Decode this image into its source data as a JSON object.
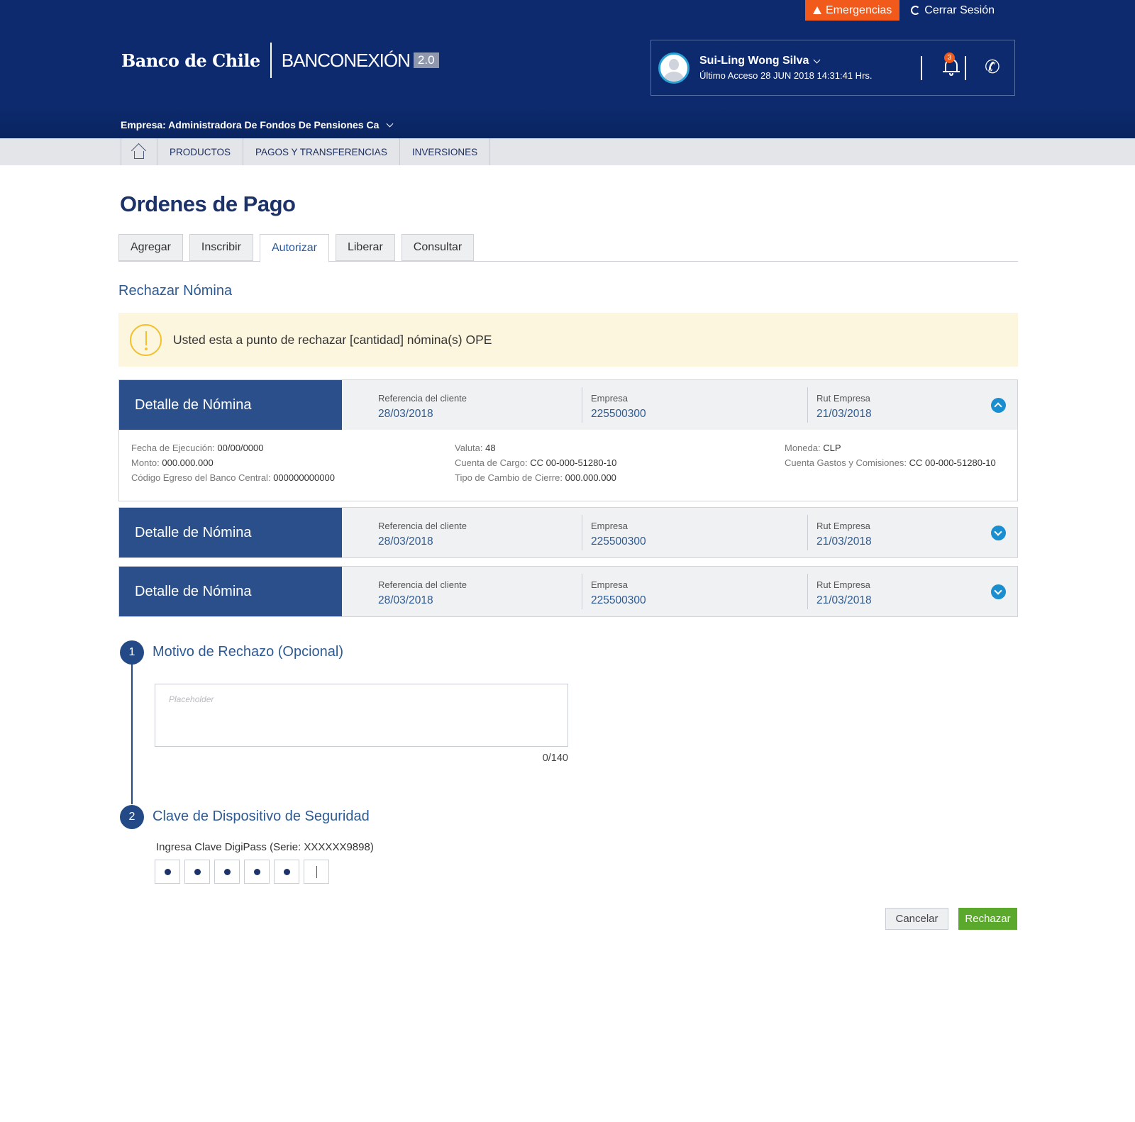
{
  "header": {
    "emergencies_label": "Emergencias",
    "logout_label": "Cerrar Sesión",
    "bank_name": "Banco de Chile",
    "product_name": "BANCONEXIÓN",
    "product_version": "2.0",
    "user": {
      "name": "Sui-Ling Wong Silva",
      "last_access": "Último Acceso 28 JUN 2018 14:31:41 Hrs.",
      "notification_count": "3"
    },
    "company": "Empresa: Administradora De Fondos De Pensiones Ca"
  },
  "nav": {
    "items": [
      {
        "label": "PRODUCTOS"
      },
      {
        "label": "PAGOS Y TRANSFERENCIAS"
      },
      {
        "label": "INVERSIONES"
      }
    ]
  },
  "page": {
    "title": "Ordenes de Pago",
    "tabs": [
      {
        "label": "Agregar",
        "active": false
      },
      {
        "label": "Inscribir",
        "active": false
      },
      {
        "label": "Autorizar",
        "active": true
      },
      {
        "label": "Liberar",
        "active": false
      },
      {
        "label": "Consultar",
        "active": false
      }
    ],
    "subtitle": "Rechazar Nómina",
    "alert_text": "Usted esta a punto de rechazar [cantidad] nómina(s) OPE"
  },
  "cards": [
    {
      "title": "Detalle de Nómina",
      "expanded": true,
      "ref_label": "Referencia del cliente",
      "ref_value": "28/03/2018",
      "empresa_label": "Empresa",
      "empresa_value": "225500300",
      "rut_label": "Rut Empresa",
      "rut_value": "21/03/2018",
      "details": {
        "fecha_ejecucion_label": "Fecha de Ejecución:",
        "fecha_ejecucion_value": "00/00/0000",
        "monto_label": "Monto:",
        "monto_value": "000.000.000",
        "codigo_label": "Código Egreso del Banco Central:",
        "codigo_value": "000000000000",
        "valuta_label": "Valuta:",
        "valuta_value": "48",
        "cuenta_cargo_label": "Cuenta de Cargo:",
        "cuenta_cargo_value": "CC 00-000-51280-10",
        "tipo_cambio_label": "Tipo de Cambio de Cierre:",
        "tipo_cambio_value": "000.000.000",
        "moneda_label": "Moneda:",
        "moneda_value": "CLP",
        "cuenta_gastos_label": "Cuenta Gastos y Comisiones:",
        "cuenta_gastos_value": "CC 00-000-51280-10"
      }
    },
    {
      "title": "Detalle de Nómina",
      "expanded": false,
      "ref_label": "Referencia del cliente",
      "ref_value": "28/03/2018",
      "empresa_label": "Empresa",
      "empresa_value": "225500300",
      "rut_label": "Rut Empresa",
      "rut_value": "21/03/2018"
    },
    {
      "title": "Detalle de Nómina",
      "expanded": false,
      "ref_label": "Referencia del cliente",
      "ref_value": "28/03/2018",
      "empresa_label": "Empresa",
      "empresa_value": "225500300",
      "rut_label": "Rut Empresa",
      "rut_value": "21/03/2018"
    }
  ],
  "steps": [
    {
      "number": "1",
      "title": "Motivo de Rechazo (Opcional)"
    },
    {
      "number": "2",
      "title": "Clave de Dispositivo de Seguridad"
    }
  ],
  "reason": {
    "placeholder": "Placeholder",
    "counter": "0/140"
  },
  "digipass": {
    "label": "Ingresa Clave DigiPass (Serie: XXXXXX9898)",
    "filled_digits": 5,
    "total_digits": 6
  },
  "actions": {
    "cancel_label": "Cancelar",
    "reject_label": "Rechazar"
  },
  "colors": {
    "header_bg": "#0c2a6d",
    "emergency": "#f25a1c",
    "card_title_bg": "#2a4f8a",
    "accent_blue": "#2d5a92",
    "toggle_blue": "#1a8ecf",
    "reject_green": "#5aa92d",
    "alert_bg": "#fdf6de"
  }
}
